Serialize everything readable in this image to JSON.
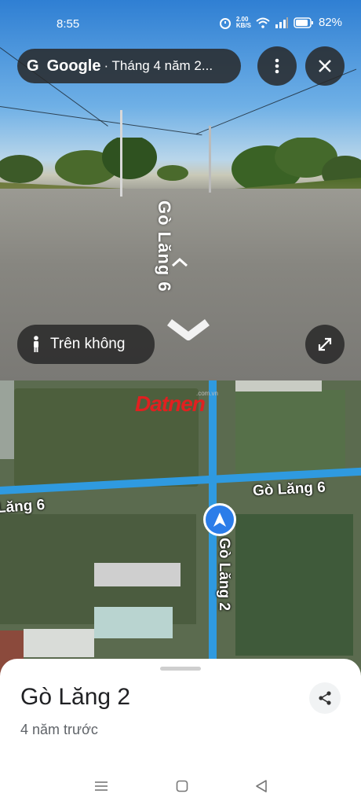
{
  "status_bar": {
    "time": "8:55",
    "net_speed": "2.00",
    "net_unit": "KB/S",
    "battery": "82%",
    "icons": [
      "alarm-icon",
      "wifi-icon",
      "signal-icon",
      "battery-icon"
    ]
  },
  "top_bar": {
    "brand": "Google",
    "date": "· Tháng 4 năm 2..."
  },
  "streetview": {
    "street_label": "Gò Lăng 6",
    "aerial_button_label": "Trên không"
  },
  "map": {
    "watermark": "Datnen",
    "watermark_sub": ".com.vn",
    "street_h_left": "Lăng 6",
    "street_h_right": "Gò Lăng 6",
    "street_v": "Gò Lăng 2"
  },
  "sheet": {
    "title": "Gò Lăng 2",
    "subtitle": "4 năm trước"
  },
  "colors": {
    "accent": "#2b7de9",
    "road_line": "#2f9ae0",
    "watermark": "#e02020"
  }
}
